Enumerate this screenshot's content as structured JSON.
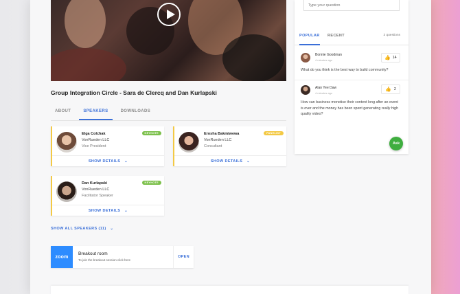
{
  "session": {
    "title": "Group Integration Circle - Sara de Clercq and Dan Kurlapski"
  },
  "tabs": [
    {
      "label": "ABOUT"
    },
    {
      "label": "SPEAKERS"
    },
    {
      "label": "DOWNLOADS"
    }
  ],
  "speakers": [
    {
      "name": "Elga Colchak",
      "company": "VonRueden LLC",
      "role": "Vice President",
      "badge": "KEYNOTE",
      "details": "SHOW DETAILS"
    },
    {
      "name": "Erosha Bakmiwewa",
      "company": "VonRueden LLC",
      "role": "Consultant",
      "badge": "PANELIST",
      "details": "SHOW DETAILS"
    },
    {
      "name": "Dan Kurlapski",
      "company": "VonRueden LLC",
      "role": "Facilitator Speaker",
      "badge": "KEYNOTE",
      "details": "SHOW DETAILS"
    }
  ],
  "show_all": "SHOW ALL SPEAKERS (11)",
  "breakout": {
    "logo": "zoom",
    "title": "Breakout room",
    "subtitle": "To join the breakout session click here",
    "open": "OPEN"
  },
  "qa": {
    "placeholder": "Type your question",
    "tab_popular": "POPULAR",
    "tab_recent": "RECENT",
    "count": "2 questions",
    "questions": [
      {
        "name": "Bonnie Goodman",
        "time": "4 minutes ago",
        "likes": "14",
        "text": "What do you think is the best way to build community?"
      },
      {
        "name": "Alan Yee Daw",
        "time": "4 minutes ago",
        "likes": "2",
        "text": "How can business monotise their content long after an event is over and the money has been spent generating really high quality video?"
      }
    ],
    "ask": "Ask"
  },
  "icons": {
    "play": "play-icon",
    "chevron": "chevron-down-icon",
    "thumb": "thumbs-up-icon"
  },
  "colors": {
    "accent": "#3a6fd8",
    "keynote": "#7cc04b",
    "panelist": "#f3c944",
    "zoom": "#2d8cff",
    "ask": "#3fae3f"
  }
}
